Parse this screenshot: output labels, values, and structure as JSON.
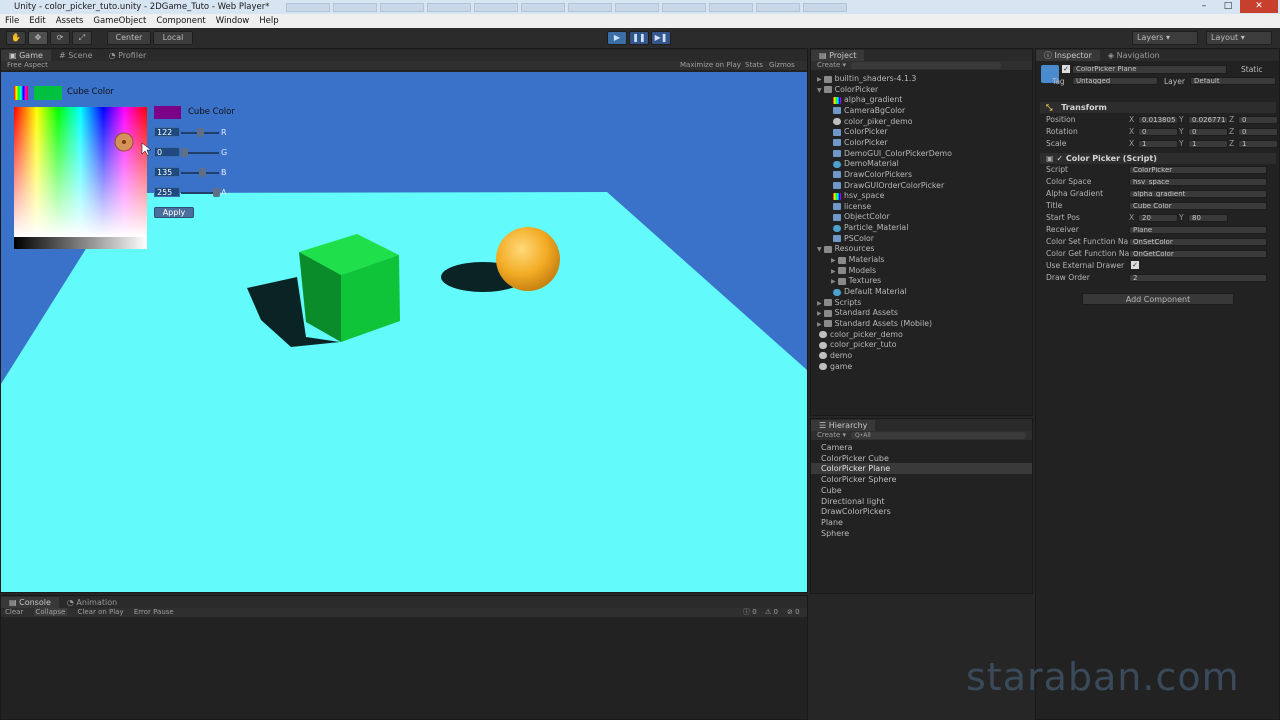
{
  "window": {
    "title": "Unity - color_picker_tuto.unity - 2DGame_Tuto - Web Player*",
    "controls": [
      "–",
      "□",
      "✕"
    ]
  },
  "menubar": [
    "File",
    "Edit",
    "Assets",
    "GameObject",
    "Component",
    "Window",
    "Help"
  ],
  "toolbar": {
    "pivot": "Center",
    "space": "Local",
    "layers": "Layers",
    "layout": "Layout"
  },
  "game": {
    "tabs": [
      "Game",
      "Scene",
      "Profiler"
    ],
    "aspect": "Free Aspect",
    "options": [
      "Maximize on Play",
      "Stats",
      "Gizmos"
    ]
  },
  "picker": {
    "title": "Cube Color",
    "panel_title": "Cube Color",
    "swatch_color": "#00c040",
    "preview_color": "#7a0087",
    "r": "122",
    "g": "0",
    "b": "135",
    "a": "255",
    "labels": [
      "R",
      "G",
      "B",
      "A"
    ],
    "apply": "Apply"
  },
  "project": {
    "tab": "Project",
    "create": "Create",
    "items": [
      {
        "label": "builtin_shaders-4.1.3",
        "indent": 0,
        "kind": "folder",
        "arrow": "▶"
      },
      {
        "label": "ColorPicker",
        "indent": 0,
        "kind": "folder",
        "arrow": "▼"
      },
      {
        "label": "alpha_gradient",
        "indent": 1,
        "kind": "image",
        "arrow": ""
      },
      {
        "label": "CameraBgColor",
        "indent": 1,
        "kind": "script",
        "arrow": ""
      },
      {
        "label": "color_piker_demo",
        "indent": 1,
        "kind": "scene",
        "arrow": ""
      },
      {
        "label": "ColorPicker",
        "indent": 1,
        "kind": "script",
        "arrow": ""
      },
      {
        "label": "ColorPicker",
        "indent": 1,
        "kind": "script",
        "arrow": ""
      },
      {
        "label": "DemoGUI_ColorPickerDemo",
        "indent": 1,
        "kind": "script",
        "arrow": ""
      },
      {
        "label": "DemoMaterial",
        "indent": 1,
        "kind": "mat",
        "arrow": ""
      },
      {
        "label": "DrawColorPickers",
        "indent": 1,
        "kind": "script",
        "arrow": ""
      },
      {
        "label": "DrawGUIOrderColorPicker",
        "indent": 1,
        "kind": "script",
        "arrow": ""
      },
      {
        "label": "hsv_space",
        "indent": 1,
        "kind": "image",
        "arrow": ""
      },
      {
        "label": "license",
        "indent": 1,
        "kind": "script",
        "arrow": ""
      },
      {
        "label": "ObjectColor",
        "indent": 1,
        "kind": "script",
        "arrow": ""
      },
      {
        "label": "Particle_Material",
        "indent": 1,
        "kind": "mat",
        "arrow": ""
      },
      {
        "label": "PSColor",
        "indent": 1,
        "kind": "script",
        "arrow": ""
      },
      {
        "label": "Resources",
        "indent": 0,
        "kind": "folder",
        "arrow": "▼"
      },
      {
        "label": "Materials",
        "indent": 1,
        "kind": "folder",
        "arrow": "▶"
      },
      {
        "label": "Models",
        "indent": 1,
        "kind": "folder",
        "arrow": "▶"
      },
      {
        "label": "Textures",
        "indent": 1,
        "kind": "folder",
        "arrow": "▶"
      },
      {
        "label": "Default Material",
        "indent": 1,
        "kind": "mat",
        "arrow": ""
      },
      {
        "label": "Scripts",
        "indent": 0,
        "kind": "folder",
        "arrow": "▶"
      },
      {
        "label": "Standard Assets",
        "indent": 0,
        "kind": "folder",
        "arrow": "▶"
      },
      {
        "label": "Standard Assets (Mobile)",
        "indent": 0,
        "kind": "folder",
        "arrow": "▶"
      },
      {
        "label": "color_picker_demo",
        "indent": 0,
        "kind": "scene",
        "arrow": ""
      },
      {
        "label": "color_picker_tuto",
        "indent": 0,
        "kind": "scene",
        "arrow": ""
      },
      {
        "label": "demo",
        "indent": 0,
        "kind": "scene",
        "arrow": ""
      },
      {
        "label": "game",
        "indent": 0,
        "kind": "scene",
        "arrow": ""
      }
    ]
  },
  "hierarchy": {
    "tab": "Hierarchy",
    "create": "Create",
    "search_placeholder": "Q•All",
    "items": [
      "Camera",
      "ColorPicker Cube",
      "ColorPicker Plane",
      "ColorPicker Sphere",
      "Cube",
      "Directional light",
      "DrawColorPickers",
      "Plane",
      "Sphere"
    ],
    "selected_index": 2
  },
  "inspector": {
    "tabs": [
      "Inspector",
      "Navigation"
    ],
    "object_name": "ColorPicker Plane",
    "static": "Static",
    "tag_label": "Tag",
    "tag": "Untagged",
    "layer_label": "Layer",
    "layer": "Default",
    "transform": {
      "header": "Transform",
      "rows": [
        {
          "label": "Position",
          "x": "0.013805",
          "y": "0.026771",
          "z": "0"
        },
        {
          "label": "Rotation",
          "x": "0",
          "y": "0",
          "z": "0"
        },
        {
          "label": "Scale",
          "x": "1",
          "y": "1",
          "z": "1"
        }
      ]
    },
    "script_comp": {
      "header": "Color Picker (Script)",
      "rows": [
        {
          "label": "Script",
          "value": "ColorPicker"
        },
        {
          "label": "Color Space",
          "value": "hsv_space"
        },
        {
          "label": "Alpha Gradient",
          "value": "alpha_gradient"
        },
        {
          "label": "Title",
          "value": "Cube Color"
        },
        {
          "label": "Start Pos",
          "x": "20",
          "y": "80"
        },
        {
          "label": "Receiver",
          "value": "Plane"
        },
        {
          "label": "Color Set Function Na",
          "value": "OnSetColor"
        },
        {
          "label": "Color Get Function Na",
          "value": "OnGetColor"
        },
        {
          "label": "Use External Drawer",
          "check": "✓"
        },
        {
          "label": "Draw Order",
          "value": "2"
        }
      ]
    },
    "add_component": "Add Component"
  },
  "console": {
    "tabs": [
      "Console",
      "Animation"
    ],
    "buttons": [
      "Clear",
      "Collapse",
      "Clear on Play",
      "Error Pause"
    ],
    "counts": [
      "0",
      "0",
      "0"
    ]
  },
  "watermark": "staraban.com",
  "colors": {
    "sky": "#3b72c9",
    "floor": "#62fafa",
    "cube": "#10c43a",
    "sphere": "#f7b52c"
  }
}
